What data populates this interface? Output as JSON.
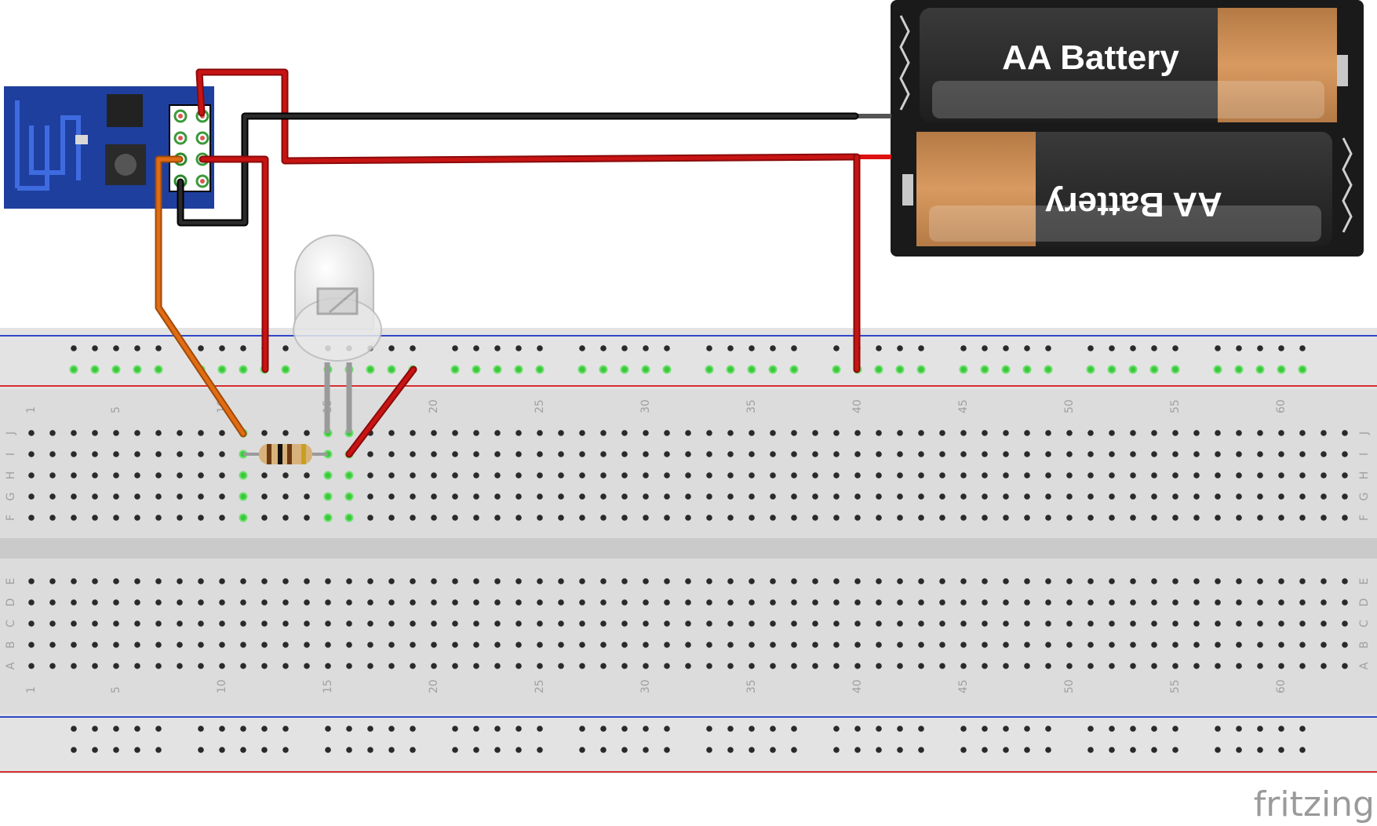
{
  "battery": {
    "top_label": "AA Battery",
    "bottom_label": "AA Battery"
  },
  "breadboard": {
    "column_numbers": [
      "1",
      "5",
      "10",
      "15",
      "20",
      "25",
      "30",
      "35",
      "40",
      "45",
      "50",
      "55",
      "60"
    ],
    "upper_row_letters": [
      "J",
      "I",
      "H",
      "G",
      "F"
    ],
    "lower_row_letters": [
      "E",
      "D",
      "C",
      "B",
      "A"
    ],
    "colors": {
      "body": "#d9d9d9",
      "rail_red": "#d63030",
      "rail_blue": "#3048c8",
      "active_hole": "#3cc83c"
    }
  },
  "wires": {
    "colors": {
      "red": "#c81414",
      "black": "#1a1a1a",
      "orange": "#e06c14"
    }
  },
  "components": [
    "esp8266-module",
    "battery-holder-2xAA",
    "led",
    "resistor"
  ],
  "logo": "fritzing"
}
